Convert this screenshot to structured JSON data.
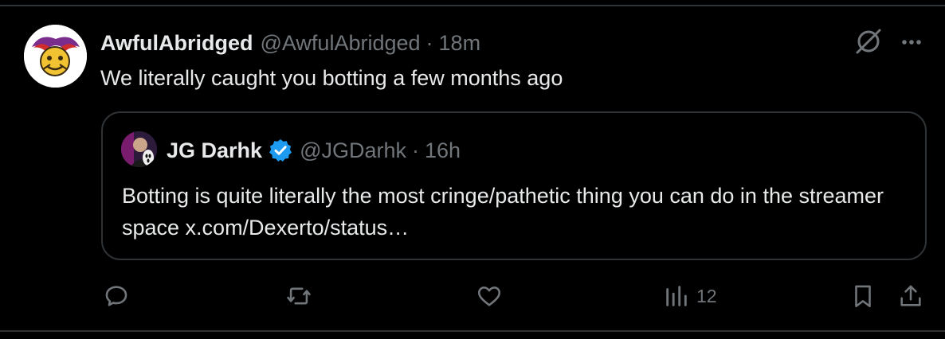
{
  "tweet": {
    "author_name": "AwfulAbridged",
    "author_handle": "@AwfulAbridged",
    "separator": "·",
    "time": "18m",
    "text": "We literally caught you botting a few months ago"
  },
  "quote": {
    "author_name": "JG Darhk",
    "author_handle": "@JGDarhk",
    "separator": "·",
    "time": "16h",
    "verified": true,
    "text": "Botting is quite literally the most cringe/pathetic thing you can do in the streamer space x.com/Dexerto/status…"
  },
  "actions": {
    "reply_count": "",
    "repost_count": "",
    "like_count": "",
    "views_count": "12"
  },
  "icons": [
    "grok-icon",
    "more-icon",
    "verified-badge-icon",
    "reply-icon",
    "repost-icon",
    "like-icon",
    "views-icon",
    "bookmark-icon",
    "share-icon"
  ],
  "colors": {
    "background": "#000000",
    "text_primary": "#e7e9ea",
    "text_secondary": "#71767b",
    "border": "#2f3336",
    "verified_blue": "#1d9bf0"
  }
}
